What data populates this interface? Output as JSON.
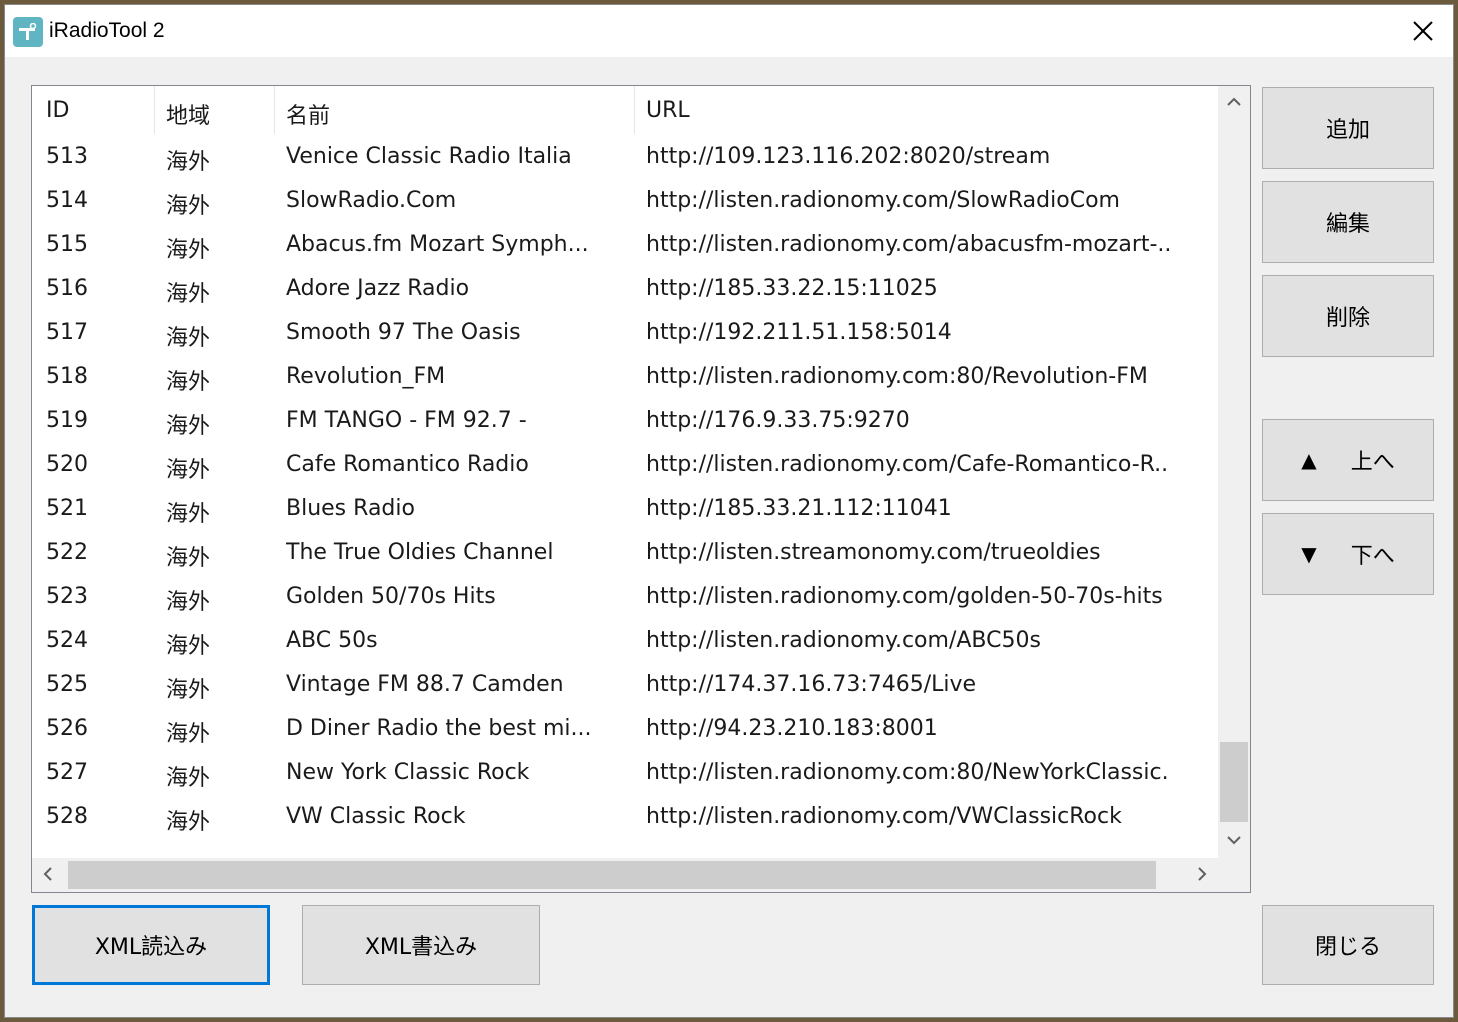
{
  "window": {
    "title": "iRadioTool 2"
  },
  "table": {
    "columns": [
      "ID",
      "地域",
      "名前",
      "URL"
    ],
    "rows": [
      {
        "id": "513",
        "region": "海外",
        "name": "Venice Classic Radio Italia",
        "url": "http://109.123.116.202:8020/stream"
      },
      {
        "id": "514",
        "region": "海外",
        "name": "SlowRadio.Com",
        "url": "http://listen.radionomy.com/SlowRadioCom"
      },
      {
        "id": "515",
        "region": "海外",
        "name": "Abacus.fm Mozart Symph...",
        "url": "http://listen.radionomy.com/abacusfm-mozart-.."
      },
      {
        "id": "516",
        "region": "海外",
        "name": "Adore Jazz Radio",
        "url": "http://185.33.22.15:11025"
      },
      {
        "id": "517",
        "region": "海外",
        "name": "Smooth 97 The Oasis",
        "url": "http://192.211.51.158:5014"
      },
      {
        "id": "518",
        "region": "海外",
        "name": "Revolution_FM",
        "url": "http://listen.radionomy.com:80/Revolution-FM"
      },
      {
        "id": "519",
        "region": "海外",
        "name": "FM TANGO - FM 92.7 -",
        "url": "http://176.9.33.75:9270"
      },
      {
        "id": "520",
        "region": "海外",
        "name": "Cafe Romantico Radio",
        "url": "http://listen.radionomy.com/Cafe-Romantico-R.."
      },
      {
        "id": "521",
        "region": "海外",
        "name": "Blues Radio",
        "url": "http://185.33.21.112:11041"
      },
      {
        "id": "522",
        "region": "海外",
        "name": "The True Oldies Channel",
        "url": "http://listen.streamonomy.com/trueoldies"
      },
      {
        "id": "523",
        "region": "海外",
        "name": "Golden 50/70s Hits",
        "url": "http://listen.radionomy.com/golden-50-70s-hits"
      },
      {
        "id": "524",
        "region": "海外",
        "name": "ABC 50s",
        "url": "http://listen.radionomy.com/ABC50s"
      },
      {
        "id": "525",
        "region": "海外",
        "name": "Vintage FM 88.7 Camden",
        "url": "http://174.37.16.73:7465/Live"
      },
      {
        "id": "526",
        "region": "海外",
        "name": "D Diner Radio the best mi...",
        "url": "http://94.23.210.183:8001"
      },
      {
        "id": "527",
        "region": "海外",
        "name": "New York Classic Rock",
        "url": "http://listen.radionomy.com:80/NewYorkClassic."
      },
      {
        "id": "528",
        "region": "海外",
        "name": "VW Classic Rock",
        "url": "http://listen.radionomy.com/VWClassicRock"
      }
    ]
  },
  "buttons": {
    "add": "追加",
    "edit": "編集",
    "delete": "削除",
    "up": "上へ",
    "down": "下へ",
    "xml_read": "XML読込み",
    "xml_write": "XML書込み",
    "close": "閉じる"
  },
  "icons": {
    "up_arrow": "▲",
    "down_arrow": "▼"
  },
  "colors": {
    "focus_border": "#0078d7",
    "app_icon": "#5fb6c2"
  }
}
